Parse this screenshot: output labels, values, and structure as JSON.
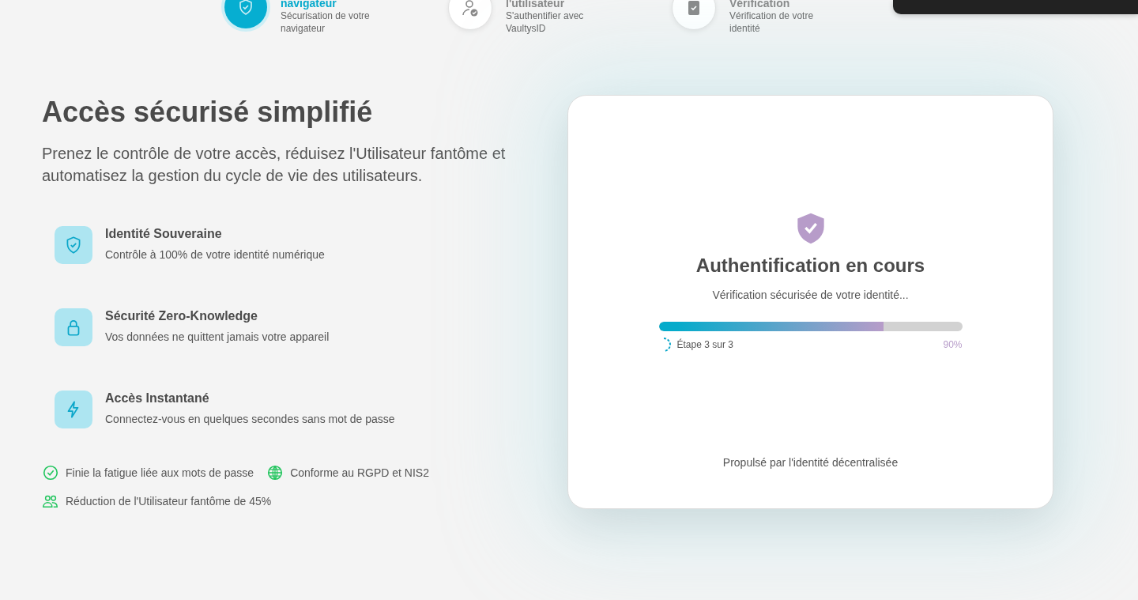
{
  "steps": [
    {
      "title": "navigateur",
      "subtitle": "Sécurisation de votre navigateur",
      "kind": "shield",
      "selected": true
    },
    {
      "title": "l'utilisateur",
      "subtitle": "S'authentifier avec VaultysID",
      "kind": "user",
      "selected": false
    },
    {
      "title": "Vérification",
      "subtitle": "Vérification de votre identité",
      "kind": "clipboard",
      "selected": false
    }
  ],
  "hero": {
    "title": "Accès sécurisé simplifié",
    "lead": "Prenez le contrôle de votre accès, réduisez l'Utilisateur fantôme et automatisez la gestion du cycle de vie des utilisateurs."
  },
  "features": [
    {
      "kind": "shield",
      "title": "Identité Souveraine",
      "text": "Contrôle à 100% de votre identité numérique"
    },
    {
      "kind": "lock",
      "title": "Sécurité Zero-Knowledge",
      "text": "Vos données ne quittent jamais votre appareil"
    },
    {
      "kind": "bolt",
      "title": "Accès Instantané",
      "text": "Connectez-vous en quelques secondes sans mot de passe"
    }
  ],
  "benefits": [
    {
      "kind": "check",
      "text": "Finie la fatigue liée aux mots de passe"
    },
    {
      "kind": "globe",
      "text": "Conforme au RGPD et NIS2"
    },
    {
      "kind": "users",
      "text": "Réduction de l'Utilisateur fantôme de 45%"
    }
  ],
  "auth_card": {
    "title": "Authentification en cours",
    "subtitle": "Vérification sécurisée de votre identité...",
    "level": 0.74,
    "step": "Étape 3 sur 3",
    "percent": "90%",
    "footer": "Propulsé par l'identité décentralisée"
  }
}
